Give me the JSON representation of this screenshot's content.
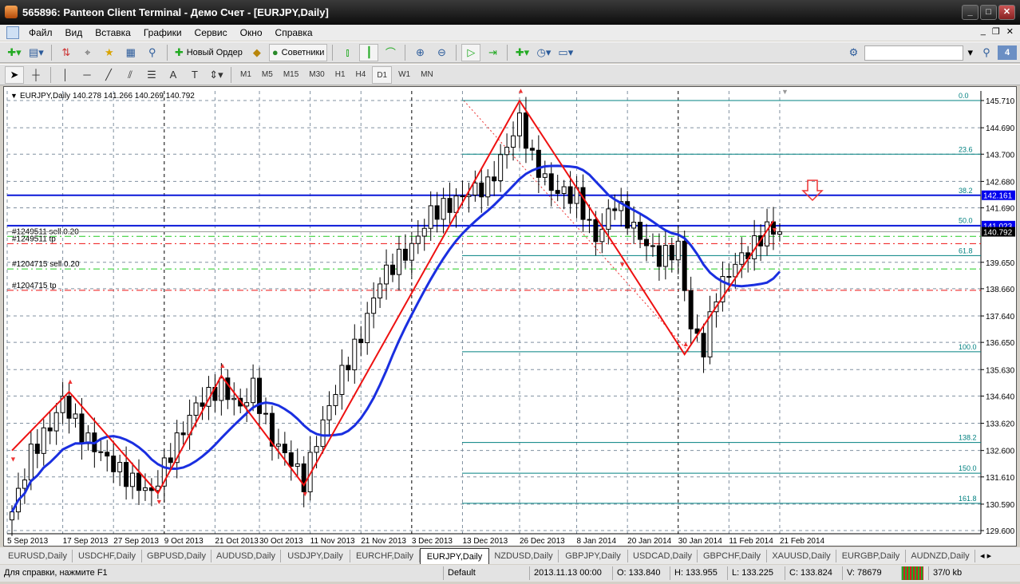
{
  "window": {
    "title": "565896: Panteon Client Terminal - Демо Счет - [EURJPY,Daily]",
    "min": "_",
    "max": "□",
    "close": "✕"
  },
  "menu": [
    "Файл",
    "Вид",
    "Вставка",
    "Графики",
    "Сервис",
    "Окно",
    "Справка"
  ],
  "toolbar": {
    "new_order": "Новый Ордер",
    "experts": "Советники",
    "search_placeholder": "",
    "notifications": "4"
  },
  "timeframes": [
    "M1",
    "M5",
    "M15",
    "M30",
    "H1",
    "H4",
    "D1",
    "W1",
    "MN"
  ],
  "active_timeframe": "D1",
  "chart": {
    "header": "EURJPY,Daily  140.278 141.266 140.269 140.792",
    "price_ticks": [
      "145.710",
      "144.690",
      "143.700",
      "142.680",
      "141.690",
      "139.650",
      "138.660",
      "137.640",
      "136.650",
      "135.630",
      "134.640",
      "133.620",
      "132.600",
      "131.610",
      "130.590",
      "129.600"
    ],
    "date_ticks": [
      "5 Sep 2013",
      "17 Sep 2013",
      "27 Sep 2013",
      "9 Oct 2013",
      "21 Oct 2013",
      "30 Oct 2013",
      "11 Nov 2013",
      "21 Nov 2013",
      "3 Dec 2013",
      "13 Dec 2013",
      "26 Dec 2013",
      "8 Jan 2014",
      "20 Jan 2014",
      "30 Jan 2014",
      "11 Feb 2014",
      "21 Feb 2014"
    ],
    "price_badges": {
      "line1": "142.161",
      "line2": "141.023",
      "bid": "140.792"
    },
    "orders": [
      {
        "label": "#1249511 sell 0.20",
        "price": 140.62,
        "color": "#22cc22"
      },
      {
        "label": "#1249511 tp",
        "price": 140.35,
        "color": "#ee1111"
      },
      {
        "label": "#1204715 sell 0.20",
        "price": 139.4,
        "color": "#22cc22"
      },
      {
        "label": "#1204715 tp",
        "price": 138.6,
        "color": "#ee1111"
      }
    ],
    "fibo": [
      {
        "label": "0.0",
        "price": 145.71
      },
      {
        "label": "23.6",
        "price": 143.7
      },
      {
        "label": "38.2",
        "price": 142.16
      },
      {
        "label": "50.0",
        "price": 141.03
      },
      {
        "label": "61.8",
        "price": 139.9
      },
      {
        "label": "100.0",
        "price": 136.3
      },
      {
        "label": "138.2",
        "price": 132.9
      },
      {
        "label": "150.0",
        "price": 131.75
      },
      {
        "label": "161.8",
        "price": 130.62
      }
    ]
  },
  "chart_data": {
    "type": "candlestick",
    "symbol": "EURJPY",
    "timeframe": "Daily",
    "ylim": [
      129.6,
      145.71
    ],
    "close_waypoints": [
      [
        0,
        130.3
      ],
      [
        3,
        132.5
      ],
      [
        6,
        133.5
      ],
      [
        8,
        134.5
      ],
      [
        11,
        133.2
      ],
      [
        14,
        132.5
      ],
      [
        18,
        131.6
      ],
      [
        22,
        131.0
      ],
      [
        25,
        132.5
      ],
      [
        29,
        134.3
      ],
      [
        33,
        135.0
      ],
      [
        36,
        134.2
      ],
      [
        38,
        135.0
      ],
      [
        41,
        133.0
      ],
      [
        44,
        132.2
      ],
      [
        46,
        131.4
      ],
      [
        48,
        133.0
      ],
      [
        52,
        135.5
      ],
      [
        55,
        136.9
      ],
      [
        58,
        139.0
      ],
      [
        61,
        139.8
      ],
      [
        63,
        140.2
      ],
      [
        66,
        141.5
      ],
      [
        69,
        141.8
      ],
      [
        72,
        142.3
      ],
      [
        75,
        142.5
      ],
      [
        78,
        144.0
      ],
      [
        80,
        145.0
      ],
      [
        82,
        143.5
      ],
      [
        85,
        142.4
      ],
      [
        89,
        142.1
      ],
      [
        92,
        140.5
      ],
      [
        95,
        141.9
      ],
      [
        99,
        140.6
      ],
      [
        102,
        139.8
      ],
      [
        105,
        140.2
      ],
      [
        107,
        137.2
      ],
      [
        109,
        136.4
      ],
      [
        111,
        138.5
      ],
      [
        114,
        139.6
      ],
      [
        117,
        140.3
      ],
      [
        119,
        140.9
      ],
      [
        121,
        140.79
      ]
    ],
    "zigzag": [
      [
        0,
        132.6
      ],
      [
        9,
        134.8
      ],
      [
        23,
        131.0
      ],
      [
        33,
        135.4
      ],
      [
        46,
        131.3
      ],
      [
        80,
        145.7
      ],
      [
        96,
        139.9
      ],
      [
        106,
        136.2
      ],
      [
        120,
        141.2
      ]
    ],
    "ma_period": 14,
    "hlines": [
      142.161,
      141.023
    ]
  },
  "tabs": [
    "EURUSD,Daily",
    "USDCHF,Daily",
    "GBPUSD,Daily",
    "AUDUSD,Daily",
    "USDJPY,Daily",
    "EURCHF,Daily",
    "EURJPY,Daily",
    "NZDUSD,Daily",
    "GBPJPY,Daily",
    "USDCAD,Daily",
    "GBPCHF,Daily",
    "XAUUSD,Daily",
    "EURGBP,Daily",
    "AUDNZD,Daily"
  ],
  "active_tab": "EURJPY,Daily",
  "status": {
    "help": "Для справки, нажмите F1",
    "profile": "Default",
    "time": "2013.11.13 00:00",
    "open": "O: 133.840",
    "high": "H: 133.955",
    "low": "L: 133.225",
    "close": "C: 133.824",
    "volume": "V: 78679",
    "traffic": "37/0 kb"
  },
  "colors": {
    "bull": "#ffffff",
    "bear": "#000000",
    "ma": "#1a2fe0",
    "zigzag": "#ee1111",
    "fibo": "#008080",
    "hline": "#0a18d8"
  }
}
